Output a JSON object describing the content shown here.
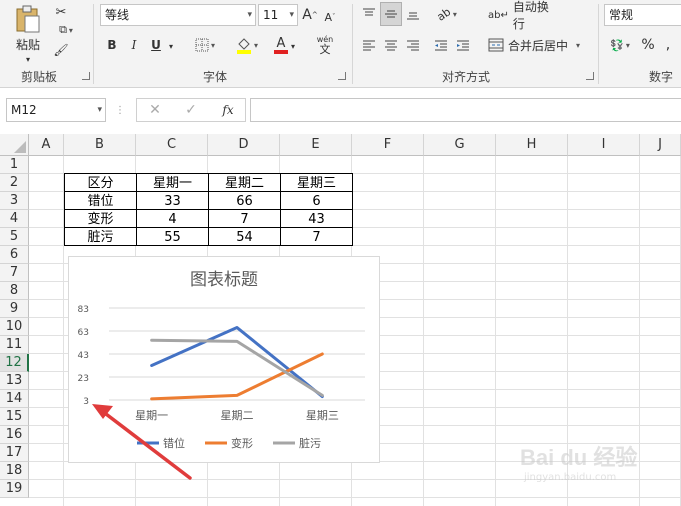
{
  "ribbon": {
    "clipboard": {
      "paste_label": "粘贴",
      "group_label": "剪贴板"
    },
    "font": {
      "font_name": "等线",
      "font_size": "11",
      "bold": "B",
      "italic": "I",
      "underline": "U",
      "font_color_letter": "A",
      "wen_label": "wén",
      "wen_char": "文",
      "group_label": "字体"
    },
    "alignment": {
      "wrap_text": "自动换行",
      "merge_center": "合并后居中",
      "group_label": "对齐方式"
    },
    "number": {
      "format": "常规",
      "percent": "%",
      "group_label": "数字"
    }
  },
  "formula_bar": {
    "name_box": "M12",
    "fx": "fx",
    "content": ""
  },
  "sheet": {
    "columns": [
      "A",
      "B",
      "C",
      "D",
      "E",
      "F",
      "G",
      "H",
      "I",
      "J"
    ],
    "rows": [
      "1",
      "2",
      "3",
      "4",
      "5",
      "6",
      "7",
      "8",
      "9",
      "10",
      "11",
      "12",
      "13",
      "14",
      "15",
      "16",
      "17",
      "18",
      "19"
    ],
    "selected_row": "12",
    "table": {
      "header": [
        "区分",
        "星期一",
        "星期二",
        "星期三"
      ],
      "rows": [
        [
          "错位",
          "33",
          "66",
          "6"
        ],
        [
          "变形",
          "4",
          "7",
          "43"
        ],
        [
          "脏污",
          "55",
          "54",
          "7"
        ]
      ]
    }
  },
  "chart_data": {
    "type": "line",
    "title": "图表标题",
    "categories": [
      "星期一",
      "星期二",
      "星期三"
    ],
    "ytick_labels": [
      "83",
      "63",
      "43",
      "23",
      "3"
    ],
    "ylim": [
      3,
      83
    ],
    "grid": true,
    "legend_position": "bottom",
    "series": [
      {
        "name": "错位",
        "values": [
          33,
          66,
          6
        ],
        "color": "#4472c4"
      },
      {
        "name": "变形",
        "values": [
          4,
          7,
          43
        ],
        "color": "#ed7d31"
      },
      {
        "name": "脏污",
        "values": [
          55,
          54,
          7
        ],
        "color": "#a5a5a5"
      }
    ]
  },
  "annotation": {
    "arrow_color": "#e03c3c"
  },
  "watermark": {
    "brand": "Bai du 经验",
    "url": "jingyan.baidu.com"
  }
}
